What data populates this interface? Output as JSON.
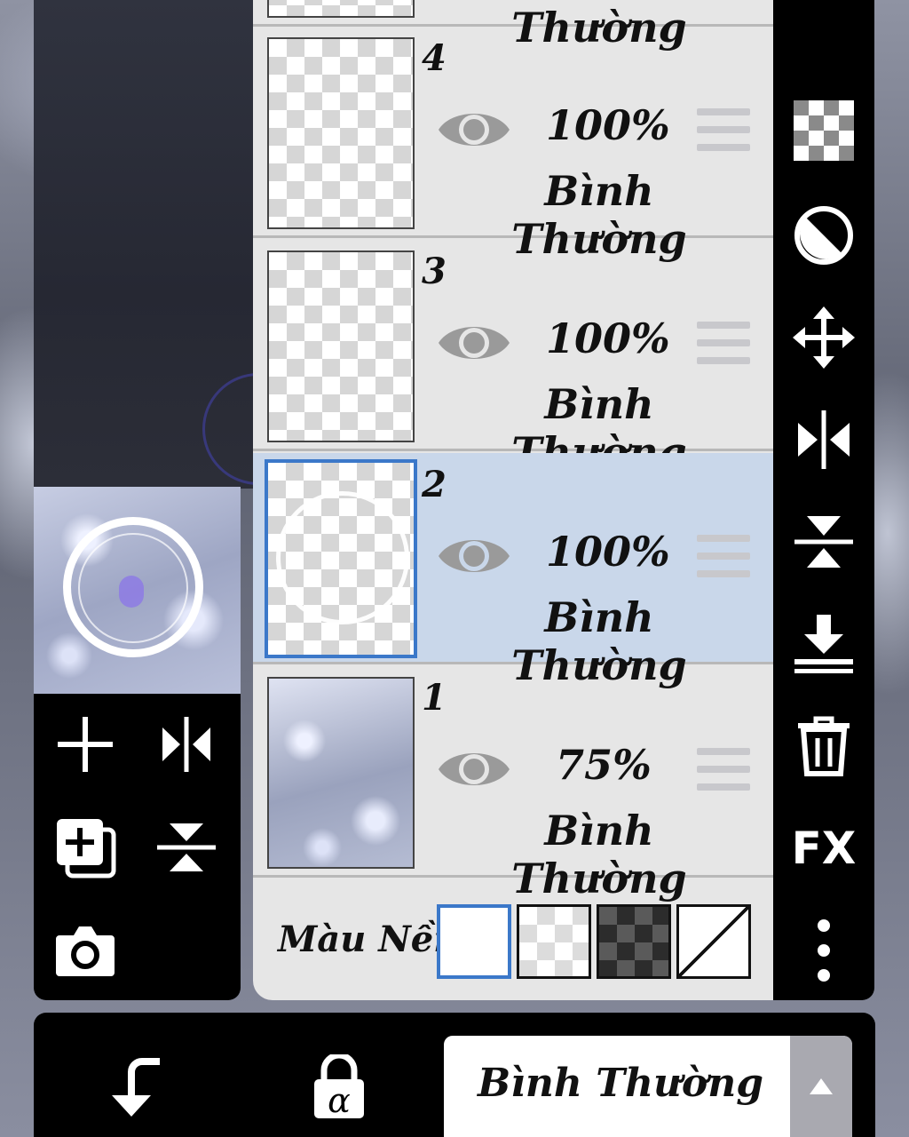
{
  "layers": [
    {
      "number": "4",
      "opacity": "100%",
      "blend": "Bình Thường",
      "selected": false
    },
    {
      "number": "3",
      "opacity": "100%",
      "blend": "Bình Thường",
      "selected": false
    },
    {
      "number": "2",
      "opacity": "100%",
      "blend": "Bình Thường",
      "selected": true
    },
    {
      "number": "1",
      "opacity": "75%",
      "blend": "Bình Thường",
      "selected": false
    }
  ],
  "partial_layer": {
    "blend": "Bình Thường"
  },
  "background": {
    "label": "Màu Nền"
  },
  "right_tools": {
    "fx_label": "FX"
  },
  "bottom": {
    "blend_mode": "Bình Thường"
  },
  "colors": {
    "selection": "#3b78c9",
    "selected_row": "#c9d7ea",
    "panel": "#e6e6e6"
  }
}
